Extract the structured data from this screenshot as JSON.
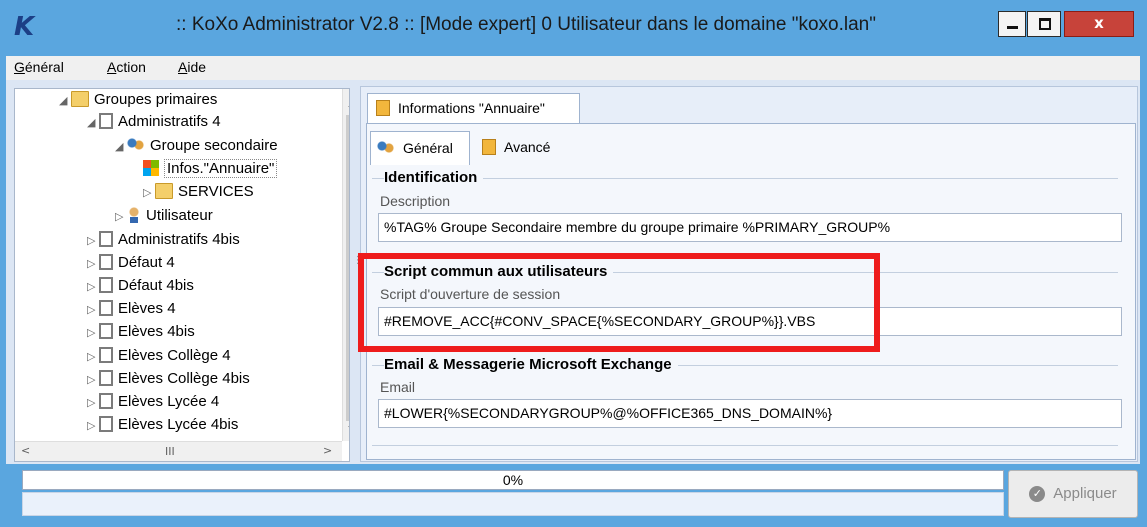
{
  "window": {
    "logo": "K",
    "title": ":: KoXo Administrator V2.8 :: [Mode expert] 0 Utilisateur dans le domaine \"koxo.lan\"",
    "close": "x"
  },
  "menu": [
    "Général",
    "Action",
    "Aide"
  ],
  "tree": {
    "items": [
      {
        "label": "Groupes primaires",
        "icon": "folder-icon",
        "exp": "◢"
      },
      {
        "label": "Administratifs 4",
        "icon": "doc-icon",
        "exp": "◢"
      },
      {
        "label": "Groupe secondaire",
        "icon": "users-icon",
        "exp": "◢"
      },
      {
        "label": "Infos.\"Annuaire\"",
        "icon": "windows-icon",
        "exp": ""
      },
      {
        "label": "SERVICES",
        "icon": "folder-icon",
        "exp": "▷"
      },
      {
        "label": "Utilisateur",
        "icon": "user-icon",
        "exp": "▷"
      },
      {
        "label": "Administratifs 4bis",
        "icon": "doc-icon",
        "exp": "▷"
      },
      {
        "label": "Défaut 4",
        "icon": "doc-icon",
        "exp": "▷"
      },
      {
        "label": "Défaut 4bis",
        "icon": "doc-icon",
        "exp": "▷"
      },
      {
        "label": "Elèves 4",
        "icon": "doc-icon",
        "exp": "▷"
      },
      {
        "label": "Elèves 4bis",
        "icon": "doc-icon",
        "exp": "▷"
      },
      {
        "label": "Elèves Collège 4",
        "icon": "doc-icon",
        "exp": "▷"
      },
      {
        "label": "Elèves Collège 4bis",
        "icon": "doc-icon",
        "exp": "▷"
      },
      {
        "label": "Elèves Lycée 4",
        "icon": "doc-icon",
        "exp": "▷"
      },
      {
        "label": "Elèves Lycée 4bis",
        "icon": "doc-icon",
        "exp": "▷"
      }
    ],
    "hscroll_thumb": "III"
  },
  "tabs": {
    "outer": "Informations \"Annuaire\"",
    "general": "Général",
    "advanced": "Avancé"
  },
  "identification": {
    "title": "Identification",
    "description_label": "Description",
    "description_value": "%TAG% Groupe Secondaire membre du groupe primaire %PRIMARY_GROUP%"
  },
  "script": {
    "title": "Script commun aux utilisateurs",
    "label": "Script d'ouverture de session",
    "value": "#REMOVE_ACC{#CONV_SPACE{%SECONDARY_GROUP%}}.VBS"
  },
  "email": {
    "title": "Email & Messagerie Microsoft Exchange",
    "label": "Email",
    "value": "#LOWER{%SECONDARYGROUP%@%OFFICE365_DNS_DOMAIN%}"
  },
  "progress": {
    "text": "0%",
    "value": 0
  },
  "buttons": {
    "apply": "Appliquer"
  },
  "colors": {
    "titlebar": "#5aa6df",
    "highlight": "#ee1c1c",
    "selection_icon": "#f25022"
  }
}
